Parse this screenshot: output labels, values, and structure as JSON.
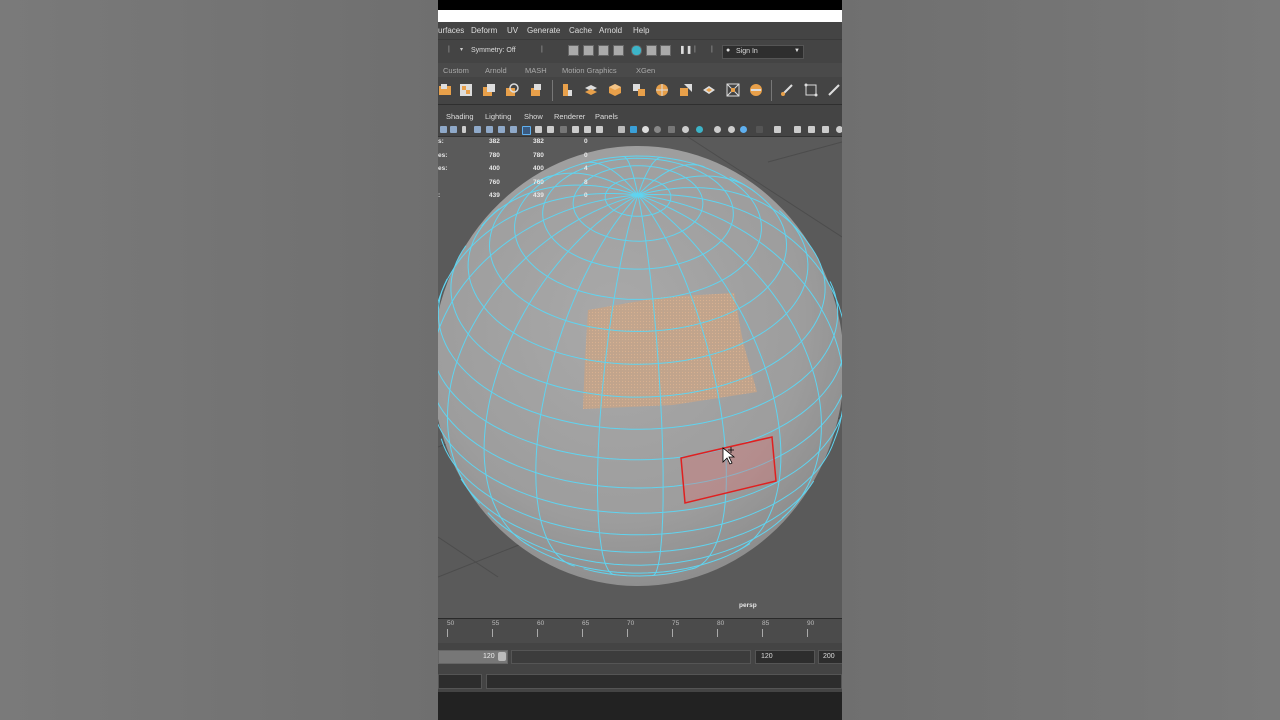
{
  "menus": [
    "urfaces",
    "Deform",
    "UV",
    "Generate",
    "Cache",
    "Arnold",
    "Help"
  ],
  "status": {
    "symmetry": "Symmetry: Off",
    "signin": "Sign In"
  },
  "shelf_tabs": [
    "Custom",
    "Arnold",
    "MASH",
    "Motion Graphics",
    "XGen"
  ],
  "panel_menus": [
    "Shading",
    "Lighting",
    "Show",
    "Renderer",
    "Panels"
  ],
  "hud": {
    "rows": [
      {
        "label": "s:",
        "a": "382",
        "b": "382",
        "c": "0"
      },
      {
        "label": "es:",
        "a": "780",
        "b": "780",
        "c": "0"
      },
      {
        "label": "es:",
        "a": "400",
        "b": "400",
        "c": "4"
      },
      {
        "label": "",
        "a": "760",
        "b": "760",
        "c": "8"
      },
      {
        "label": ":",
        "a": "439",
        "b": "439",
        "c": "0"
      }
    ]
  },
  "camera_label": "persp",
  "timeline": {
    "ticks": [
      "50",
      "55",
      "60",
      "65",
      "70",
      "75",
      "80",
      "85",
      "90"
    ]
  },
  "range": {
    "start_value": "120",
    "end_value": "120",
    "max_value": "200"
  },
  "colors": {
    "wireframe": "#5fd4f0",
    "selected_face": "#c8a486",
    "marquee": "#e02020"
  }
}
